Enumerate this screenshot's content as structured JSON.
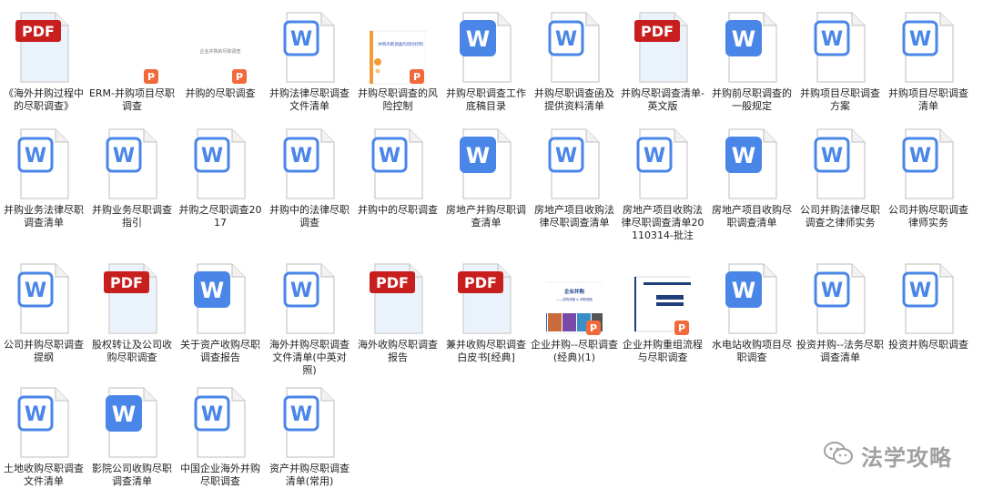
{
  "files": [
    {
      "label": "《海外并购过程中的尽职调查》",
      "type": "pdf"
    },
    {
      "label": "ERM-并购项目尽职调查",
      "type": "ppt-blank"
    },
    {
      "label": "并购的尽职调查",
      "type": "ppt-title"
    },
    {
      "label": "并购法律尽职调查文件清单",
      "type": "word"
    },
    {
      "label": "并购尽职调查的风险控制",
      "type": "ppt-orange"
    },
    {
      "label": "并购尽职调查工作底稿目录",
      "type": "word-solid"
    },
    {
      "label": "并购尽职调查函及提供资料清单",
      "type": "word"
    },
    {
      "label": "并购尽职调查清单-英文版",
      "type": "pdf"
    },
    {
      "label": "并购前尽职调查的一般规定",
      "type": "word-solid"
    },
    {
      "label": "并购项目尽职调查方案",
      "type": "word"
    },
    {
      "label": "并购项目尽职调查清单",
      "type": "word"
    },
    {
      "label": "并购业务法律尽职调查清单",
      "type": "word"
    },
    {
      "label": "并购业务尽职调查指引",
      "type": "word"
    },
    {
      "label": "并购之尽职调查2017",
      "type": "word"
    },
    {
      "label": "并购中的法律尽职调查",
      "type": "word"
    },
    {
      "label": "并购中的尽职调查",
      "type": "word"
    },
    {
      "label": "房地产并购尽职调查清单",
      "type": "word-solid"
    },
    {
      "label": "房地产项目收购法律尽职调查清单",
      "type": "word"
    },
    {
      "label": "房地产项目收购法律尽职调查清单20110314-批注",
      "type": "word"
    },
    {
      "label": "房地产项目收购尽职调查清单",
      "type": "word-solid"
    },
    {
      "label": "公司并购法律尽职调查之律师实务",
      "type": "word"
    },
    {
      "label": "公司并购尽职调查律师实务",
      "type": "word"
    },
    {
      "label": "公司并购尽职调查提纲",
      "type": "word"
    },
    {
      "label": "股权转让及公司收购尽职调查",
      "type": "pdf"
    },
    {
      "label": "关于资产收购尽职调查报告",
      "type": "word-solid"
    },
    {
      "label": "海外并购尽职调查文件清单(中英对照)",
      "type": "word"
    },
    {
      "label": "海外收购尽职调查报告",
      "type": "pdf"
    },
    {
      "label": "兼并收购尽职调查白皮书[经典]",
      "type": "pdf"
    },
    {
      "label": "企业并购--尽职调查(经典)(1)",
      "type": "ppt-photo"
    },
    {
      "label": "企业并购重组流程与尽职调查",
      "type": "ppt-dark"
    },
    {
      "label": "水电站收购项目尽职调查",
      "type": "word-solid"
    },
    {
      "label": "投资并购--法务尽职调查清单",
      "type": "word"
    },
    {
      "label": "投资并购尽职调查",
      "type": "word"
    },
    {
      "label": "土地收购尽职调查文件清单",
      "type": "word"
    },
    {
      "label": "影院公司收购尽职调查清单",
      "type": "word-solid"
    },
    {
      "label": "中国企业海外并购尽职调查",
      "type": "word"
    },
    {
      "label": "资产并购尽职调查清单(常用)",
      "type": "word"
    }
  ],
  "badges": {
    "pdf": "PDF",
    "word": "W",
    "ppt": "P"
  },
  "thumbnails": {
    "ppt_title": "企业并购的尽职调查",
    "ppt_orange": "并购尽职调查的风险控制",
    "ppt_photo": "企业并购",
    "ppt_photo_sub": "——并购流程 & 尽职调查"
  },
  "watermark": {
    "text": "法学攻略",
    "icon": "wechat-icon"
  },
  "colors": {
    "word": "#4a86e8",
    "pdf": "#c81e1e",
    "ppt": "#f06a3b",
    "watermark": "#a0a0a0"
  }
}
